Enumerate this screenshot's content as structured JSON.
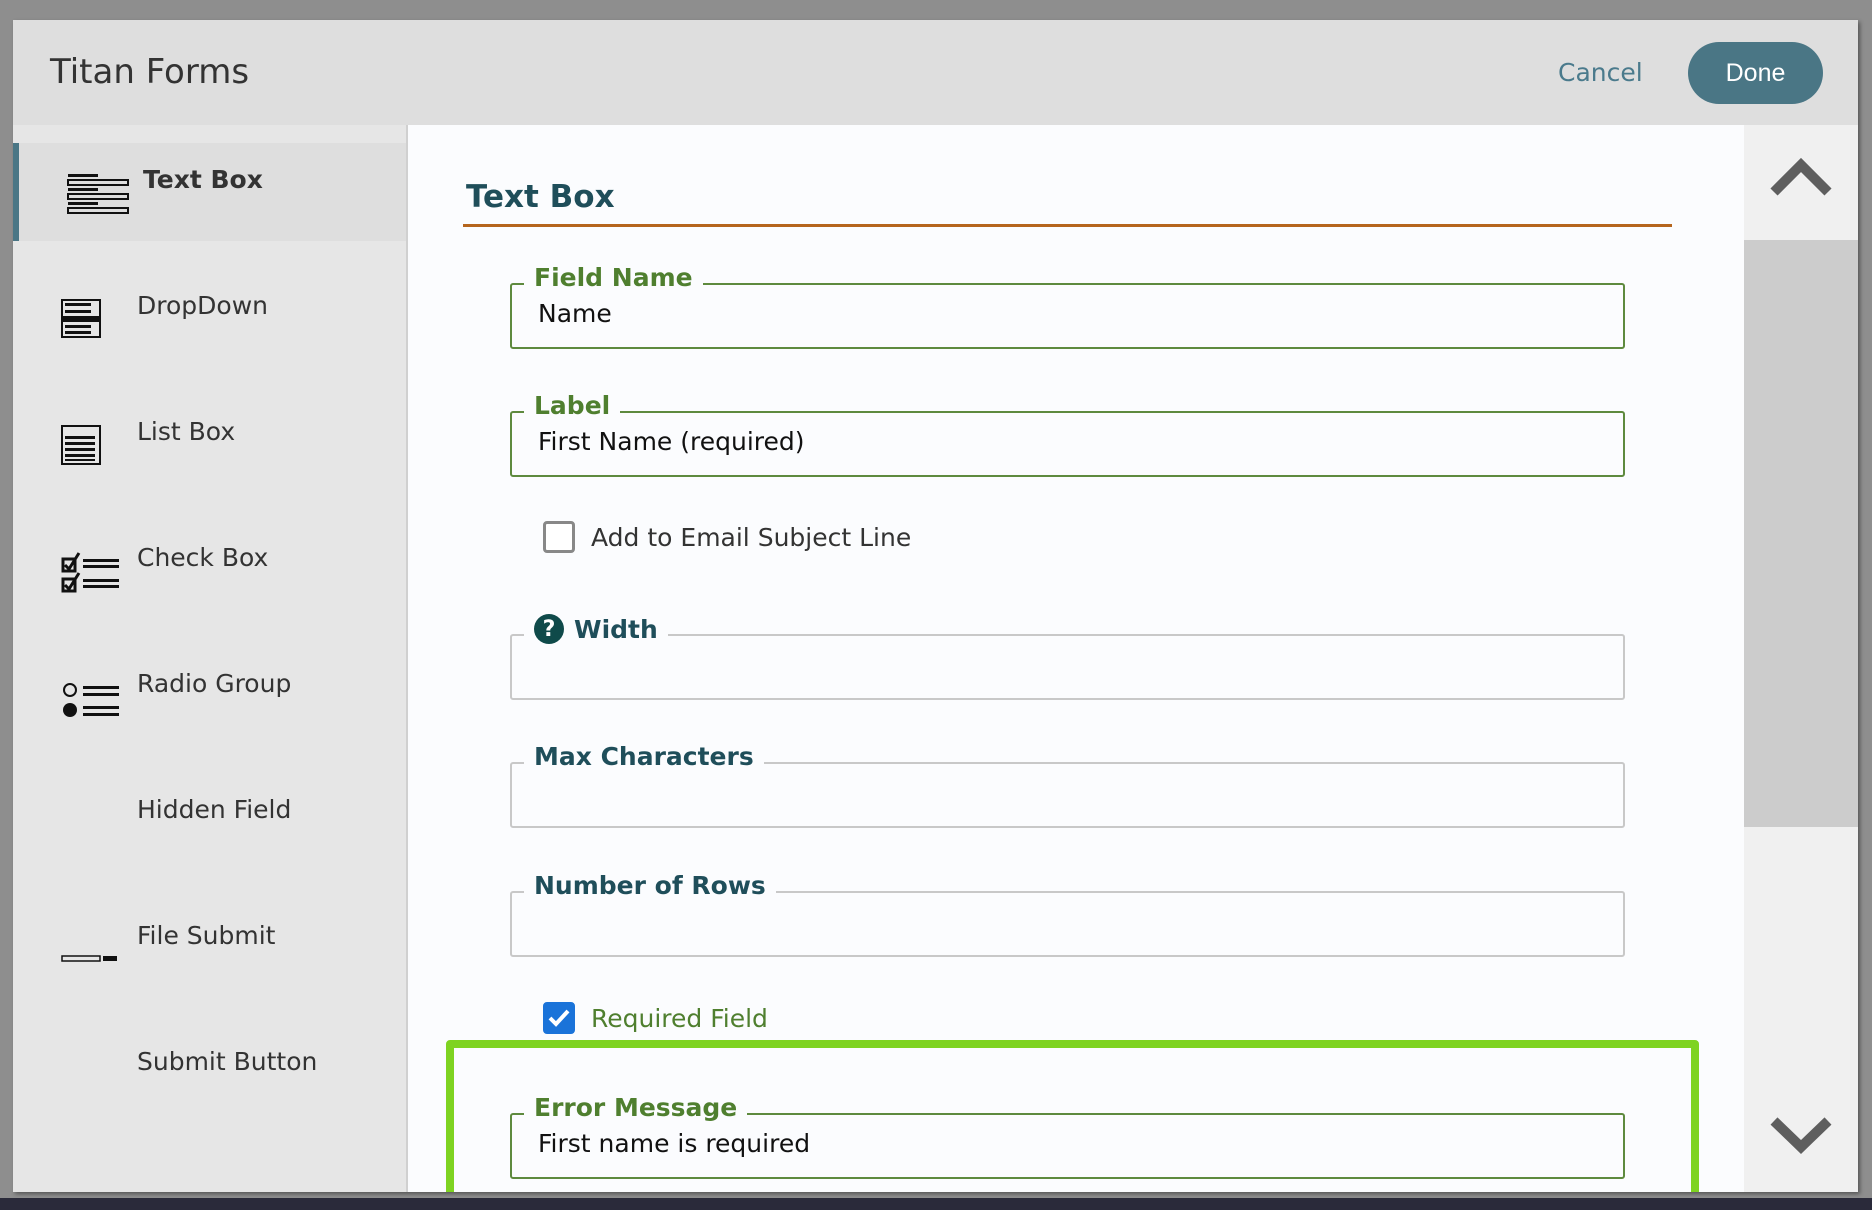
{
  "header": {
    "title": "Titan Forms",
    "cancel_label": "Cancel",
    "done_label": "Done"
  },
  "colors": {
    "accent": "#4a7685",
    "section_rule": "#b5651d",
    "green_label": "#4f7f2f",
    "highlight": "#7ed321",
    "checkbox_checked": "#1a73d9"
  },
  "sidebar": {
    "items": [
      {
        "label": "Text Box",
        "icon": "text-box-icon",
        "active": true
      },
      {
        "label": "DropDown",
        "icon": "dropdown-icon"
      },
      {
        "label": "List Box",
        "icon": "list-box-icon"
      },
      {
        "label": "Check Box",
        "icon": "check-box-icon"
      },
      {
        "label": "Radio Group",
        "icon": "radio-group-icon"
      },
      {
        "label": "Hidden Field",
        "icon": ""
      },
      {
        "label": "File Submit",
        "icon": "file-submit-icon"
      },
      {
        "label": "Submit Button",
        "icon": ""
      }
    ]
  },
  "main": {
    "section_title": "Text Box",
    "field_name": {
      "label": "Field Name",
      "value": "Name"
    },
    "label": {
      "label": "Label",
      "value": "First Name (required)"
    },
    "email_subject": {
      "label": "Add to Email Subject Line",
      "checked": false
    },
    "width": {
      "label": "Width",
      "value": "",
      "help_icon": "question-circle-icon"
    },
    "max_characters": {
      "label": "Max Characters",
      "value": ""
    },
    "number_of_rows": {
      "label": "Number of Rows",
      "value": ""
    },
    "required_field": {
      "label": "Required Field",
      "checked": true
    },
    "error_message": {
      "label": "Error Message",
      "value": "First name is required"
    }
  },
  "scrollbar": {
    "up_icon": "chevron-up-icon",
    "down_icon": "chevron-down-icon"
  }
}
